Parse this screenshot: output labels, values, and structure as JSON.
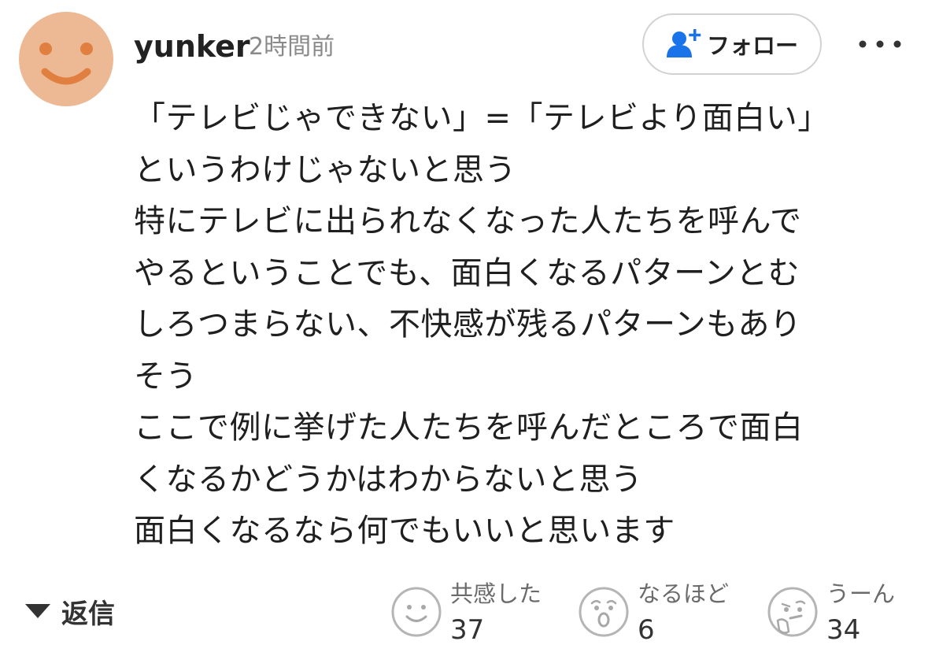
{
  "comment": {
    "user": {
      "name": "yunker",
      "avatar_color": "#ecb994"
    },
    "timestamp": "2時間前",
    "follow_button": {
      "label": "フォロー",
      "icon": "person-plus-icon",
      "icon_color": "#1a73e8"
    },
    "more_menu_icon": "more-horizontal-icon",
    "body_lines": [
      "「テレビじゃできない」=「テレビより面白い」",
      "というわけじゃないと思う",
      "特にテレビに出られなくなった人たちを呼んで",
      "やるということでも、面白くなるパターンとむ",
      "しろつまらない、不快感が残るパターンもあり",
      "そう",
      "ここで例に挙げた人たちを呼んだところで面白",
      "くなるかどうかはわからないと思う",
      "面白くなるなら何でもいいと思います"
    ],
    "reply": {
      "label": "返信",
      "icon": "caret-down-icon"
    },
    "reactions": [
      {
        "label": "共感した",
        "count": "37",
        "icon": "smile-face-icon"
      },
      {
        "label": "なるほど",
        "count": "6",
        "icon": "surprised-face-icon"
      },
      {
        "label": "うーん",
        "count": "34",
        "icon": "thinking-face-icon"
      }
    ]
  }
}
